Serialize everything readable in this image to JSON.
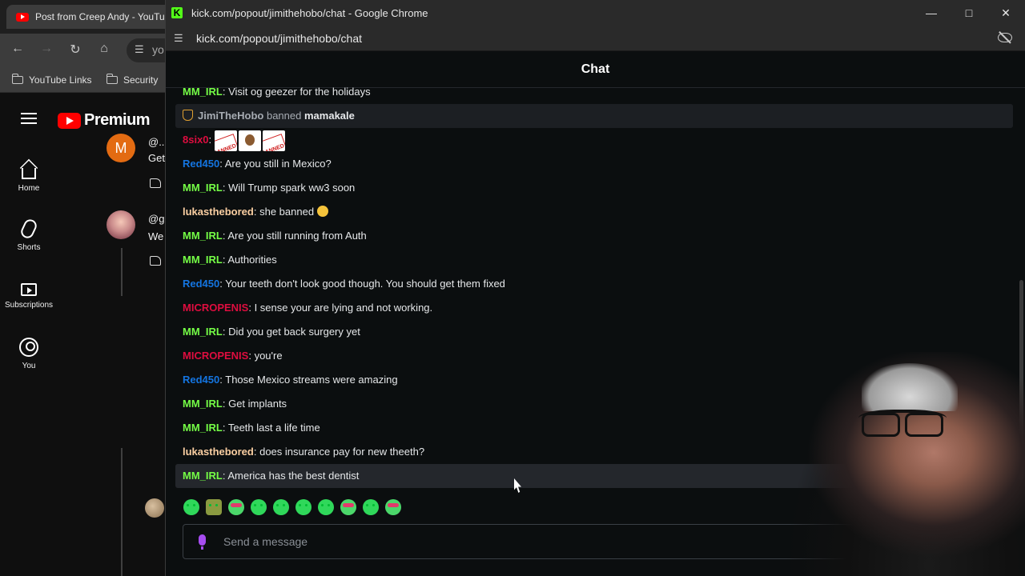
{
  "background_browser": {
    "tab_title": "Post from Creep Andy - YouTube",
    "omnibox_text": "yo",
    "bookmarks": [
      "YouTube Links",
      "Security"
    ]
  },
  "youtube": {
    "logo_text": "Premium",
    "sidebar": [
      {
        "label": "Home",
        "icon": "home-icon"
      },
      {
        "label": "Shorts",
        "icon": "shorts-icon"
      },
      {
        "label": "Subscriptions",
        "icon": "subscriptions-icon"
      },
      {
        "label": "You",
        "icon": "you-icon"
      }
    ],
    "comment_fragments": {
      "avatar_letter": "M",
      "c1_handle": "@...",
      "c1_text": "Get",
      "c2_handle": "@g",
      "c2_text": "We"
    }
  },
  "kick_window": {
    "window_title": "kick.com/popout/jimithehobo/chat - Google Chrome",
    "url": "kick.com/popout/jimithehobo/chat",
    "chat_title": "Chat",
    "send_placeholder": "Send a message",
    "colors": {
      "kick_green": "#53fc18",
      "user_green": "#75fd46",
      "user_blue": "#1475e1",
      "user_red": "#de0d3f",
      "user_orange": "#fbcfa2",
      "mic_purple": "#a64cf0"
    }
  },
  "chat": {
    "messages": [
      {
        "user": "MM_IRL",
        "color": "#75fd46",
        "text": "Visit og geezer for the holidays"
      },
      {
        "system": true,
        "actor": "JimiTheHobo",
        "action": "banned",
        "target": "mamakale"
      },
      {
        "user": "8six0",
        "color": "#de0d3f",
        "text": "",
        "emotes": [
          "banned",
          "monkey",
          "banned"
        ]
      },
      {
        "user": "Red450",
        "color": "#1475e1",
        "text": "Are you still in Mexico?"
      },
      {
        "user": "MM_IRL",
        "color": "#75fd46",
        "text": "Will Trump spark ww3 soon"
      },
      {
        "user": "lukasthebored",
        "color": "#fbcfa2",
        "text": "she banned",
        "emoji": true
      },
      {
        "user": "MM_IRL",
        "color": "#75fd46",
        "text": "Are you still running from Auth"
      },
      {
        "user": "MM_IRL",
        "color": "#75fd46",
        "text": "Authorities"
      },
      {
        "user": "Red450",
        "color": "#1475e1",
        "text": "Your teeth don't look good though. You should get them fixed"
      },
      {
        "user": "MICROPENIS",
        "color": "#de0d3f",
        "text": "I sense your are lying and not working."
      },
      {
        "user": "MM_IRL",
        "color": "#75fd46",
        "text": "Did you get back surgery yet"
      },
      {
        "user": "MICROPENIS",
        "color": "#de0d3f",
        "text": "you're"
      },
      {
        "user": "Red450",
        "color": "#1475e1",
        "text": "Those Mexico streams were amazing"
      },
      {
        "user": "MM_IRL",
        "color": "#75fd46",
        "text": "Get implants"
      },
      {
        "user": "MM_IRL",
        "color": "#75fd46",
        "text": "Teeth last a life time"
      },
      {
        "user": "lukasthebored",
        "color": "#fbcfa2",
        "text": "does insurance pay for new theeth?"
      },
      {
        "user": "MM_IRL",
        "color": "#75fd46",
        "text": "America has the best dentist",
        "hovered": true
      }
    ]
  }
}
